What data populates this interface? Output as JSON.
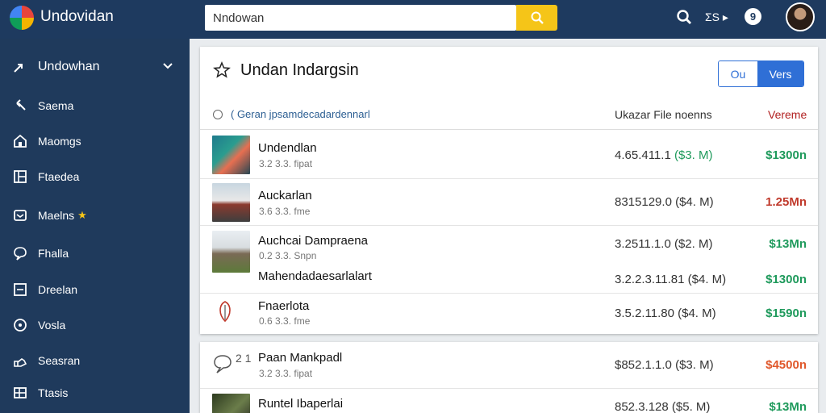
{
  "header": {
    "app_title": "Undovidan",
    "search_value": "Nndowan",
    "right_text": "ΣS ▸",
    "badge": "9"
  },
  "sidebar": {
    "items": [
      {
        "label": "Undowhan",
        "icon": "arrow-icon"
      },
      {
        "label": "Saema",
        "icon": "back-arrow-icon"
      },
      {
        "label": "Maomgs",
        "icon": "home-icon"
      },
      {
        "label": "Ftaedea",
        "icon": "grid-icon"
      },
      {
        "label": "Maelns",
        "icon": "mail-icon"
      },
      {
        "label": "Fhalla",
        "icon": "chat-icon"
      },
      {
        "label": "Dreelan",
        "icon": "square-icon"
      },
      {
        "label": "Vosla",
        "icon": "circle-icon"
      },
      {
        "label": "Seasran",
        "icon": "hand-icon"
      },
      {
        "label": "Ttasis",
        "icon": "table-icon"
      }
    ]
  },
  "panel": {
    "title": "Undan Indargsin",
    "btn_ou": "Ou",
    "btn_vers": "Vers",
    "header_left": "( Geran jpsamdecadardennarl",
    "header_mid": "Ukazar File noenns",
    "header_right": "Vereme"
  },
  "rows": [
    {
      "name": "Undendlan",
      "sub": "3.2 3.3. fipat",
      "num": "4.65.411.1",
      "paren": "($3. M)",
      "amount": "$1300n",
      "amount_color": "green",
      "thumb": "person"
    },
    {
      "name": "Auckarlan",
      "sub": "3.6 3.3. fme",
      "num": "8315129.0",
      "paren": "($4. M)",
      "amount": "1.25Mn",
      "amount_color": "red",
      "thumb": "building"
    },
    {
      "name": "Auchcai Dampraena",
      "sub": "0.2 3.3. Snpn",
      "num": "3.2511.1.0",
      "paren": "($2. M)",
      "amount": "$13Mn",
      "amount_color": "green",
      "thumb": "temple"
    },
    {
      "name": "Mahendadaesarlalart",
      "sub": "",
      "num": "3.2.2.3.11.81",
      "paren": "($4. M)",
      "amount": "$1300n",
      "amount_color": "green",
      "thumb": "none"
    },
    {
      "name": "Fnaerlota",
      "sub": "0.6 3.3. fme",
      "num": "3.5.2.11.80",
      "paren": "($4. M)",
      "amount": "$1590n",
      "amount_color": "green",
      "thumb": "logo"
    }
  ],
  "rows2": [
    {
      "name": "Paan Mankpadl",
      "sub": "3.2 3.3. fipat",
      "prefix": "2 1",
      "num": "$852.1.1.0",
      "paren": "($3. M)",
      "amount": "$4500n",
      "amount_color": "orange"
    },
    {
      "name": "Runtel Ibaperlai",
      "sub": "",
      "num": "852.3.128",
      "paren": "($5. M)",
      "amount": "$13Mn",
      "amount_color": "green"
    }
  ]
}
